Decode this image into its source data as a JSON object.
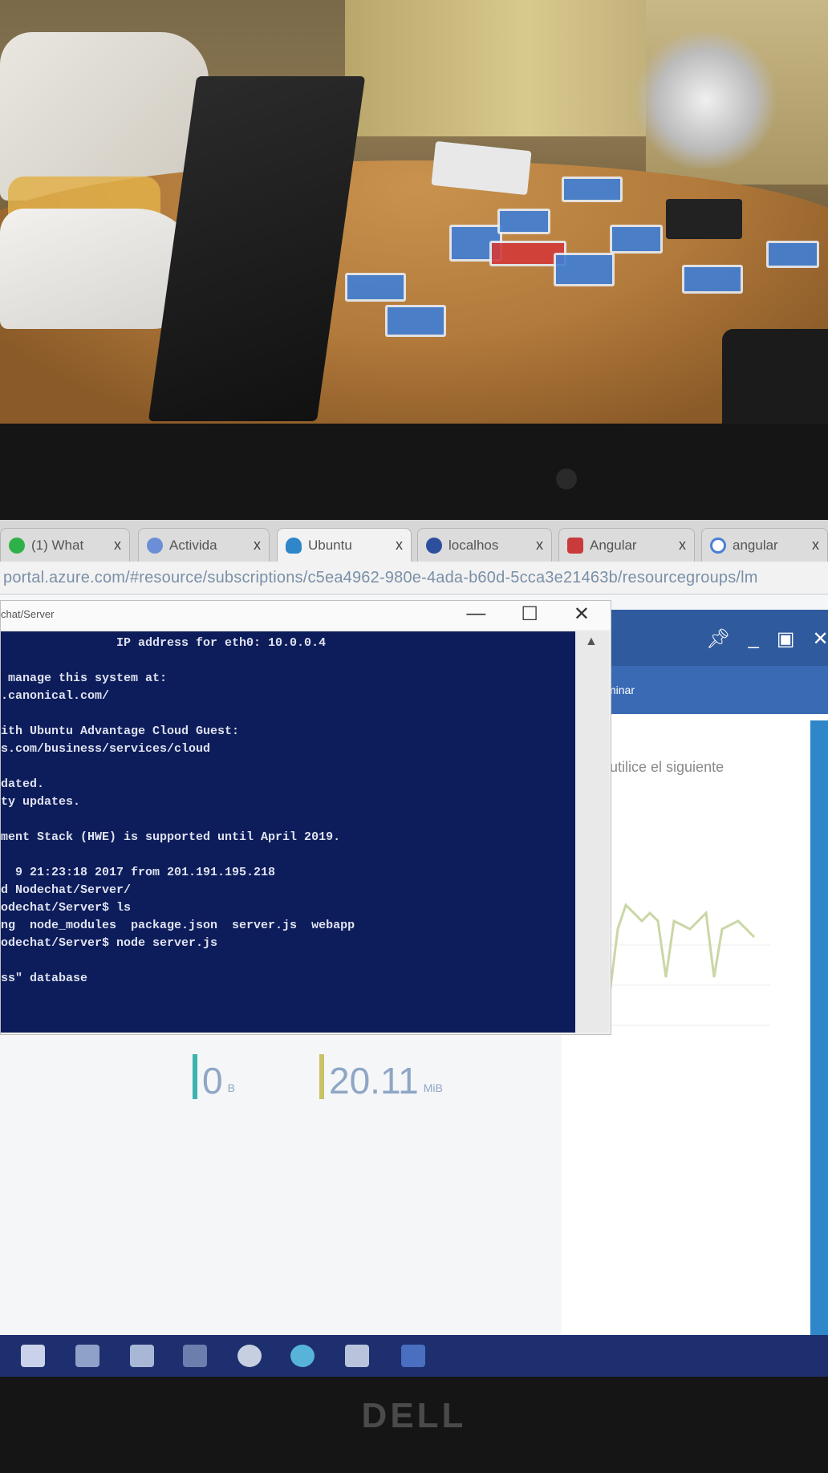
{
  "browser": {
    "tabs": [
      {
        "label": "(1) What",
        "icon": "whatsapp-icon",
        "color": "#2fb14a",
        "active": false
      },
      {
        "label": "Activida",
        "icon": "globe-icon",
        "color": "#6b8fd6",
        "active": false
      },
      {
        "label": "Ubuntu",
        "icon": "cloud-icon",
        "color": "#2f86c9",
        "active": true
      },
      {
        "label": "localhos",
        "icon": "kubernetes-icon",
        "color": "#2d4f9e",
        "active": false
      },
      {
        "label": "Angular",
        "icon": "angular-icon",
        "color": "#c93a3a",
        "active": false
      },
      {
        "label": "angular",
        "icon": "google-icon",
        "color": "#4a7fd8",
        "active": false
      }
    ],
    "close_glyph": "x",
    "url": "portal.azure.com/#resource/subscriptions/c5ea4962-980e-4ada-b60d-5cca3e21463b/resourcegroups/lm"
  },
  "terminal_window": {
    "title": "chat/Server",
    "lines": [
      {
        "text": "                IP address for eth0: 10.0.0.4"
      },
      {
        "text": ""
      },
      {
        "text": " manage this system at:"
      },
      {
        "text": ".canonical.com/"
      },
      {
        "text": ""
      },
      {
        "text": "ith Ubuntu Advantage Cloud Guest:"
      },
      {
        "text": "s.com/business/services/cloud"
      },
      {
        "text": ""
      },
      {
        "text": "dated."
      },
      {
        "text": "ty updates."
      },
      {
        "text": ""
      },
      {
        "text": "ment Stack (HWE) is supported until April 2019."
      },
      {
        "text": ""
      },
      {
        "text": "  9 21:23:18 2017 from 201.191.195.218"
      },
      {
        "text": "d Nodechat/Server/"
      },
      {
        "text": "odechat/Server$ ls"
      },
      {
        "text": "ng  node_modules  package.json  server.js  webapp"
      },
      {
        "text": "odechat/Server$ node server.js"
      },
      {
        "text": ""
      },
      {
        "text": "ss\" database"
      }
    ]
  },
  "azure": {
    "blade_action": "minar",
    "blade_text": "l, utilice el siguiente",
    "metrics": [
      {
        "value": "0",
        "unit": "B",
        "color": "#3db3b0"
      },
      {
        "value": "20.11",
        "unit": "MiB",
        "color": "#c7c265"
      }
    ]
  },
  "taskbar": {
    "icons": [
      "chat-icon",
      "calculator-icon",
      "files-icon",
      "terminal-icon",
      "chrome-icon",
      "edge-icon",
      "putty-icon",
      "app-icon"
    ]
  },
  "laptop_brand": "DELL"
}
